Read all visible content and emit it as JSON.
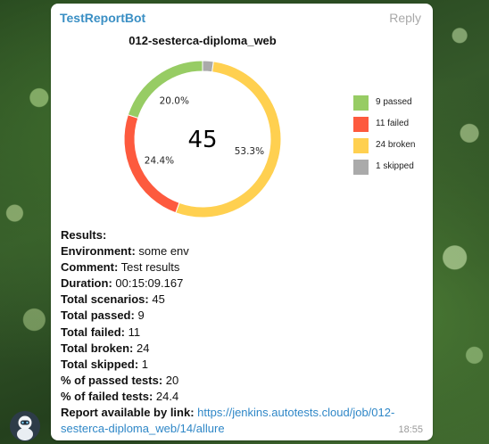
{
  "message": {
    "sender": "TestReportBot",
    "reply_label": "Reply",
    "time": "18:55"
  },
  "chart_data": {
    "type": "pie",
    "title": "012-sesterca-diploma_web",
    "center_label": "45",
    "series": [
      {
        "name": "9 passed",
        "value": 9,
        "pct_label": "20.0%",
        "color": "#97cc64"
      },
      {
        "name": "11 failed",
        "value": 11,
        "pct_label": "24.4%",
        "color": "#fd5a3e"
      },
      {
        "name": "24 broken",
        "value": 24,
        "pct_label": "53.3%",
        "color": "#ffd050"
      },
      {
        "name": "1 skipped",
        "value": 1,
        "pct_label": "",
        "color": "#aaaaaa"
      }
    ],
    "legend_position": "right"
  },
  "results": {
    "heading": "Results:",
    "lines": [
      {
        "label": "Environment:",
        "value": "some env"
      },
      {
        "label": "Comment:",
        "value": "Test results"
      },
      {
        "label": "Duration:",
        "value": "00:15:09.167"
      },
      {
        "label": "Total scenarios:",
        "value": "45"
      },
      {
        "label": "Total passed:",
        "value": "9"
      },
      {
        "label": "Total failed:",
        "value": "11"
      },
      {
        "label": "Total broken:",
        "value": "24"
      },
      {
        "label": "Total skipped:",
        "value": "1"
      },
      {
        "label": "% of passed tests:",
        "value": "20"
      },
      {
        "label": "% of failed tests:",
        "value": "24.4"
      }
    ],
    "report_label": "Report available by link:",
    "report_link_line1": "https://jenkins.autotests.cloud/job/012-",
    "report_link_line2": "sesterca-diploma_web/14/allure"
  }
}
